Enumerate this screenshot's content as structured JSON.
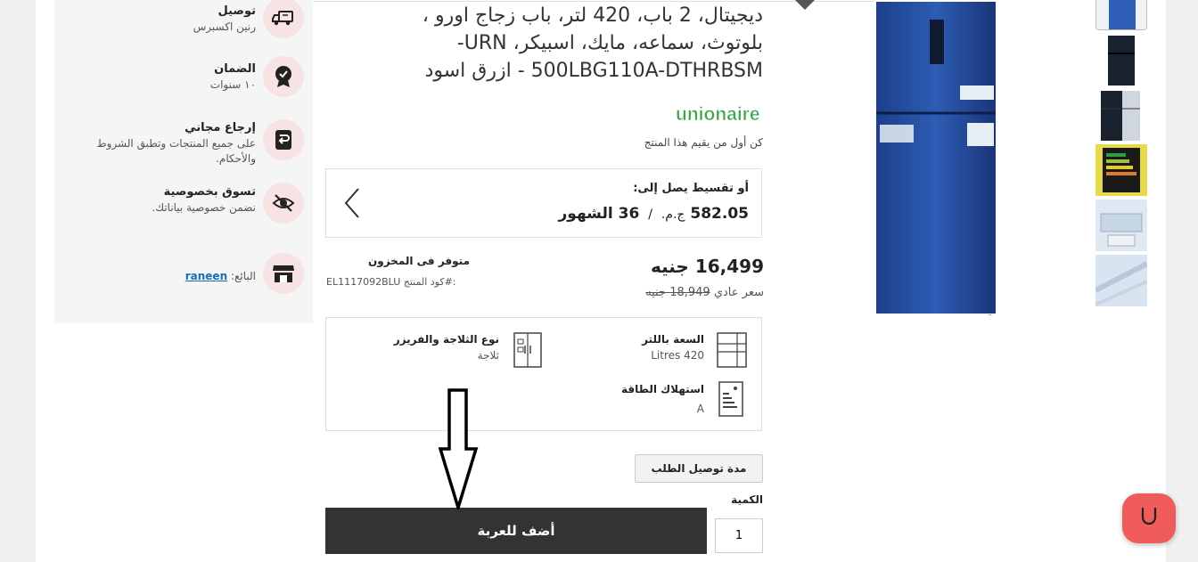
{
  "sidebar": {
    "features": [
      {
        "title": "توصيل",
        "subtitle": "رنين اكسبرس",
        "icon": "delivery-truck-icon"
      },
      {
        "title": "الضمان",
        "subtitle": "١٠ سنوات",
        "icon": "warranty-badge-icon"
      },
      {
        "title": "إرجاع مجاني",
        "subtitle": "على جميع المنتجات وتطبق الشروط والأحكام.",
        "icon": "free-return-icon"
      },
      {
        "title": "تسوق بخصوصية",
        "subtitle": "نضمن خصوصية بياناتك.",
        "icon": "privacy-eye-off-icon"
      }
    ],
    "seller": {
      "label": "البائع:",
      "name": "raneen",
      "icon": "store-icon"
    }
  },
  "product": {
    "title_lines": [
      "ديجيتال، 2 باب، 420 لتر، باب زجاج اورو ،",
      "بلوتوث، سماعه، مايك، اسبيكر، URN-",
      "500LBG110A-DTHRBSM - ازرق اسود"
    ],
    "brand": "unionaire",
    "rating_text": "كن أول من يقيم هذا المنتج",
    "installment": {
      "label": "أو تقسيط يصل إلى:",
      "amount": "582.05",
      "currency": "ج.م.",
      "separator": "/",
      "months": "36",
      "months_label": "الشهور"
    },
    "price": "16,499 جنيه",
    "old_price_label": "سعر عادي",
    "old_price": "18,949 جنيه",
    "stock": "متوفر فى المخزون",
    "sku_label": "كود المنتج#:",
    "sku": "EL1117092BLU",
    "specs": [
      {
        "label": "السعة باللتر",
        "value": "420 Litres",
        "icon": "fridge-capacity-icon"
      },
      {
        "label": "نوع الثلاجة والفريزر",
        "value": "ثلاجة",
        "icon": "fridge-type-icon"
      },
      {
        "label": "استهلاك الطاقة",
        "value": "A",
        "icon": "energy-label-icon"
      }
    ],
    "delivery_button": "مدة توصيل الطلب",
    "quantity_label": "الكمية",
    "quantity": "1",
    "add_to_cart": "أضف للعربة"
  },
  "colors": {
    "accent_dark": "#333333",
    "chat_bubble": "#f05b5b",
    "brand_green": "#3aa547",
    "link": "#1a6bb8"
  }
}
